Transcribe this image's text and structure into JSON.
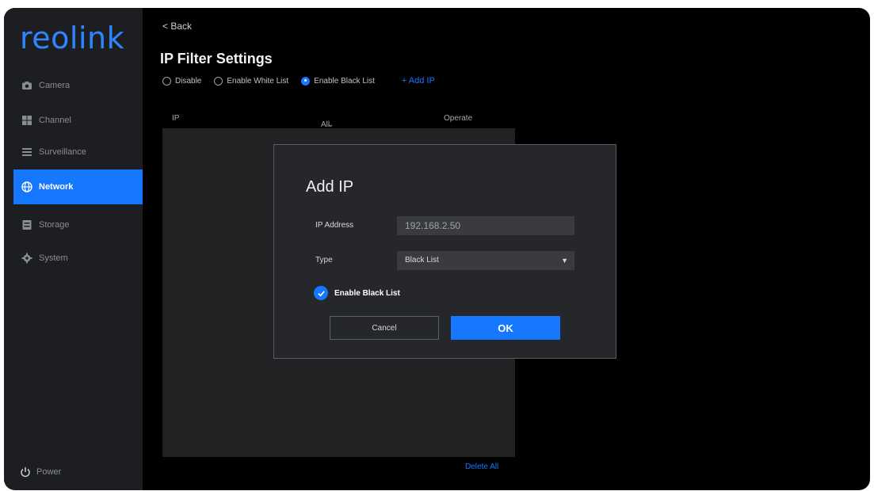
{
  "app": {
    "logo": "reolink"
  },
  "sidebar": {
    "items": [
      {
        "label": "Camera",
        "icon": "camera-icon"
      },
      {
        "label": "Channel",
        "icon": "channel-icon"
      },
      {
        "label": "Surveillance",
        "icon": "surveillance-icon"
      },
      {
        "label": "Network",
        "icon": "network-icon",
        "active": true
      },
      {
        "label": "Storage",
        "icon": "storage-icon"
      },
      {
        "label": "System",
        "icon": "gear-icon"
      }
    ],
    "power_label": "Power"
  },
  "header": {
    "back_label": "< Back",
    "title": "IP Filter Settings"
  },
  "filter_options": {
    "disable": "Disable",
    "white_list": "Enable White List",
    "black_list": "Enable Black List",
    "selected": "black_list",
    "add_ip": "+ Add IP"
  },
  "table": {
    "col_ip": "IP",
    "col_type": "All Type",
    "col_operate": "Operate",
    "bottom_link": "Delete All"
  },
  "modal": {
    "title": "Add IP",
    "ip_label": "IP Address",
    "ip_value": "192.168.2.50",
    "type_label": "Type",
    "type_value": "Black List",
    "checkbox_label": "Enable Black List",
    "cancel": "Cancel",
    "ok": "OK"
  },
  "colors": {
    "accent": "#1677ff",
    "sidebar_bg": "#1d1e21",
    "modal_bg": "#26272a"
  }
}
